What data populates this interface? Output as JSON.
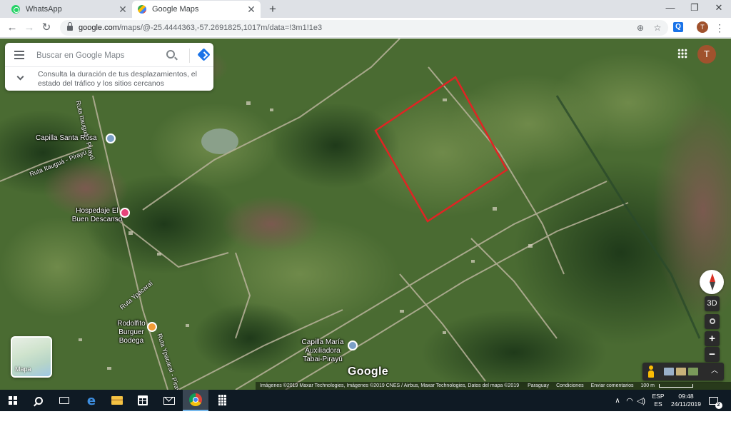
{
  "browser": {
    "tabs": [
      {
        "title": "WhatsApp",
        "active": false,
        "favicon": "whatsapp-icon"
      },
      {
        "title": "Google Maps",
        "active": true,
        "favicon": "google-maps-icon"
      }
    ],
    "close_glyph": "✕",
    "new_tab_glyph": "+",
    "window_controls": {
      "minimize": "—",
      "restore": "❐",
      "close": "✕"
    },
    "nav": {
      "back": "←",
      "forward": "→",
      "reload": "↻"
    },
    "url": {
      "host": "google.com",
      "path": "/maps/@-25.4444363,-57.2691825,1017m/data=!3m1!1e3"
    },
    "omnibox_icons": {
      "location": "⊕",
      "bookmark": "☆"
    },
    "extension_label": "Q",
    "profile_initial": "T",
    "menu_glyph": "⋮"
  },
  "maps": {
    "search": {
      "placeholder": "Buscar en Google Maps",
      "hint": "Consulta la duración de tus desplazamientos, el estado del tráfico y los sitios cercanos"
    },
    "account_initial": "T",
    "places": [
      {
        "name": "Capilla Santa Rosa",
        "kind": "church"
      },
      {
        "name": "Hospedaje El Buen Descanso",
        "kind": "hotel"
      },
      {
        "name": "Rodolfito Burguer Bodega",
        "kind": "restaurant"
      },
      {
        "name": "Capilla María Auxiliadora Tabai-Pirayú",
        "kind": "church"
      }
    ],
    "roads": [
      "Ruta Itauguá - Pirayú",
      "Ruta Ypacaraí - Pirayú",
      "Ruta Ypacaraí"
    ],
    "layer_switcher_label": "Mapa",
    "controls": {
      "tilt": "3D",
      "zoom_in": "+",
      "zoom_out": "−"
    },
    "logo": "Google",
    "attribution": {
      "imagery": "Imágenes ©2019 Maxar Technologies, Imágenes ©2019 CNES / Airbus, Maxar Technologies, Datos del mapa ©2019",
      "country": "Paraguay",
      "terms": "Condiciones",
      "feedback": "Enviar comentarios",
      "scale": "100 m"
    },
    "colors": {
      "boundary": "#e02424",
      "accent": "#1a73e8"
    }
  },
  "taskbar": {
    "tray": {
      "caret": "∧",
      "wifi": "◠",
      "volume": "◁)",
      "lang_top": "ESP",
      "lang_bottom": "ES",
      "time": "09:48",
      "date": "24/11/2019",
      "notifications": "2"
    }
  }
}
